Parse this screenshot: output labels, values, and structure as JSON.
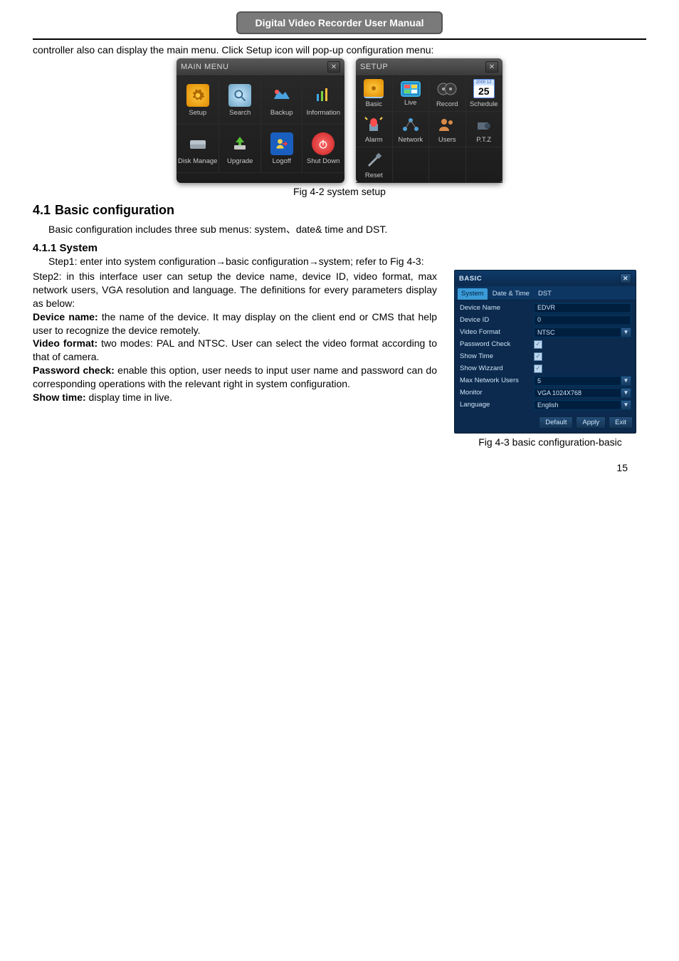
{
  "header": {
    "title": "Digital Video Recorder User Manual"
  },
  "intro": "controller also can display the main menu. Click Setup icon will pop-up configuration menu:",
  "main_menu_win": {
    "title": "MAIN MENU",
    "items": [
      {
        "label": "Setup"
      },
      {
        "label": "Search"
      },
      {
        "label": "Backup"
      },
      {
        "label": "Information"
      },
      {
        "label": "Disk Manage"
      },
      {
        "label": "Upgrade"
      },
      {
        "label": "Logoff"
      },
      {
        "label": "Shut Down"
      }
    ]
  },
  "setup_win": {
    "title": "SETUP",
    "items": [
      {
        "label": "Basic"
      },
      {
        "label": "Live"
      },
      {
        "label": "Record"
      },
      {
        "label": "Schedule"
      },
      {
        "label": "Alarm"
      },
      {
        "label": "Network"
      },
      {
        "label": "Users"
      },
      {
        "label": "P.T.Z"
      },
      {
        "label": "Reset"
      }
    ],
    "cal_month": "2000 12",
    "cal_day": "25"
  },
  "fig42_caption": "Fig 4-2 system setup",
  "section_4_1": {
    "num": "4.1",
    "title": "Basic configuration",
    "para": "Basic configuration includes three sub menus: system、date& time and DST."
  },
  "section_4_1_1": {
    "num": "4.1.1",
    "title": "System"
  },
  "steps": {
    "step1": "Step1: enter into system configuration→basic configuration→system; refer to Fig 4-3:",
    "step2a": "Step2: in this interface user can setup the device name, device ID, video format, max network users, VGA resolution and language. The definitions for every parameters display as below:",
    "devname_lbl": "Device name:",
    "devname_txt": " the name of the device. It may display on the client end or CMS that help user to recognize the device remotely.",
    "vidfmt_lbl": "Video format:",
    "vidfmt_txt": " two modes: PAL and NTSC. User can select the video format according to that of camera.",
    "pwchk_lbl": "Password check:",
    "pwchk_txt": " enable this option, user needs to input user name and password can do corresponding operations with the relevant right in system configuration.",
    "showtime_lbl": "Show time:",
    "showtime_txt": " display time in live."
  },
  "basic_dialog": {
    "title": "BASIC",
    "tabs": [
      "System",
      "Date & Time",
      "DST"
    ],
    "rows": [
      {
        "label": "Device Name",
        "type": "text",
        "value": "EDVR"
      },
      {
        "label": "Device ID",
        "type": "text",
        "value": "0"
      },
      {
        "label": "Video Format",
        "type": "select",
        "value": "NTSC"
      },
      {
        "label": "Password Check",
        "type": "check",
        "value": "checked"
      },
      {
        "label": "Show Time",
        "type": "check",
        "value": "checked"
      },
      {
        "label": "Show Wizzard",
        "type": "check",
        "value": "checked"
      },
      {
        "label": "Max Network Users",
        "type": "select",
        "value": "5"
      },
      {
        "label": "Monitor",
        "type": "select",
        "value": "VGA 1024X768"
      },
      {
        "label": "Language",
        "type": "select",
        "value": "English"
      }
    ],
    "buttons": [
      "Default",
      "Apply",
      "Exit"
    ]
  },
  "fig43_caption": "Fig 4-3 basic configuration-basic",
  "page_number": "15",
  "glyphs": {
    "close": "✕",
    "check": "✓",
    "down": "▼"
  }
}
